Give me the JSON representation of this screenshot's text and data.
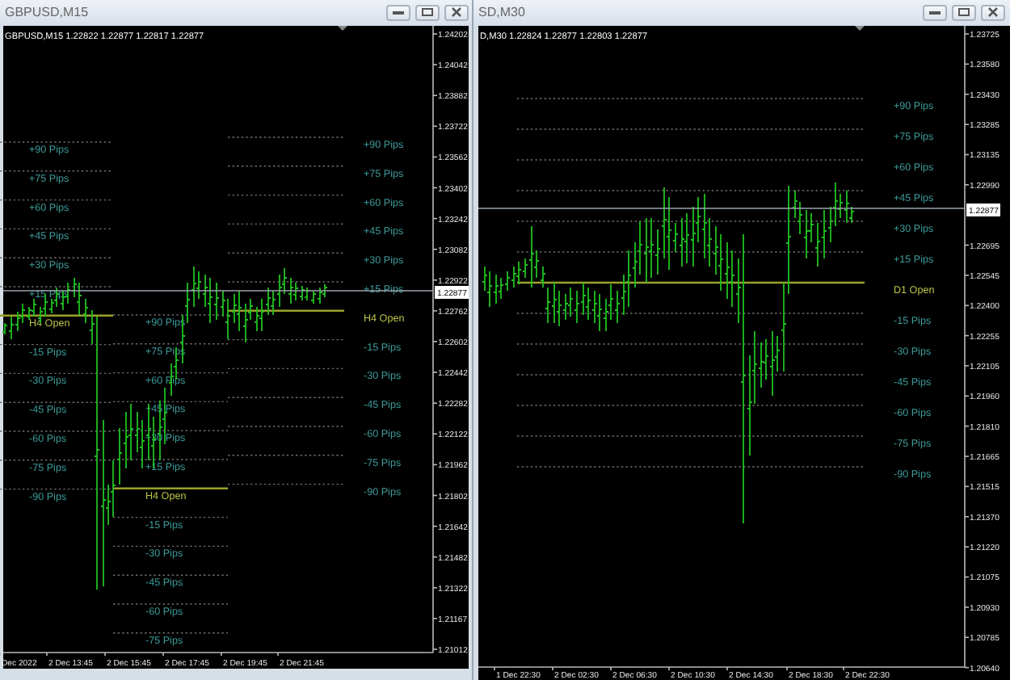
{
  "windows": [
    {
      "title": "GBPUSD,M15",
      "info": "GBPUSD,M15 1.22822 1.22877 1.22817 1.22877",
      "price_ticks": [
        "1.24202",
        "1.24042",
        "1.23882",
        "1.23722",
        "1.23562",
        "1.23402",
        "1.23242",
        "1.23082",
        "1.22922",
        "1.22762",
        "1.22602",
        "1.22442",
        "1.22282",
        "1.22122",
        "1.21962",
        "1.21802",
        "1.21642",
        "1.21482",
        "1.21322",
        "1.21167",
        "1.21012"
      ],
      "current_price": "1.22877",
      "time_labels": [
        "Dec 2022",
        "2 Dec 13:45",
        "2 Dec 15:45",
        "2 Dec 17:45",
        "2 Dec 19:45",
        "2 Dec 21:45"
      ],
      "pip_groups": [
        {
          "levels": [
            {
              "text": "+90 Pips",
              "kind": "pip"
            },
            {
              "text": "+75 Pips",
              "kind": "pip"
            },
            {
              "text": "+60 Pips",
              "kind": "pip"
            },
            {
              "text": "+45 Pips",
              "kind": "pip"
            },
            {
              "text": "+30 Pips",
              "kind": "pip"
            },
            {
              "text": "+15 Pips",
              "kind": "pip"
            },
            {
              "text": "H4 Open",
              "kind": "open"
            },
            {
              "text": "-15 Pips",
              "kind": "pip"
            },
            {
              "text": "-30 Pips",
              "kind": "pip"
            },
            {
              "text": "-45 Pips",
              "kind": "pip"
            },
            {
              "text": "-60 Pips",
              "kind": "pip"
            },
            {
              "text": "-75 Pips",
              "kind": "pip"
            },
            {
              "text": "-90 Pips",
              "kind": "pip"
            }
          ]
        },
        {
          "levels": [
            {
              "text": "+90 Pips",
              "kind": "pip"
            },
            {
              "text": "+75 Pips",
              "kind": "pip"
            },
            {
              "text": "+60 Pips",
              "kind": "pip"
            },
            {
              "text": "+45 Pips",
              "kind": "pip"
            },
            {
              "text": "+30 Pips",
              "kind": "pip"
            },
            {
              "text": "+15 Pips",
              "kind": "pip"
            },
            {
              "text": "H4 Open",
              "kind": "open"
            },
            {
              "text": "-15 Pips",
              "kind": "pip"
            },
            {
              "text": "-30 Pips",
              "kind": "pip"
            },
            {
              "text": "-45 Pips",
              "kind": "pip"
            },
            {
              "text": "-60 Pips",
              "kind": "pip"
            },
            {
              "text": "-75 Pips",
              "kind": "pip"
            }
          ]
        },
        {
          "levels": [
            {
              "text": "+90 Pips",
              "kind": "pip"
            },
            {
              "text": "+75 Pips",
              "kind": "pip"
            },
            {
              "text": "+60 Pips",
              "kind": "pip"
            },
            {
              "text": "+45 Pips",
              "kind": "pip"
            },
            {
              "text": "+30 Pips",
              "kind": "pip"
            },
            {
              "text": "+15 Pips",
              "kind": "pip"
            },
            {
              "text": "H4 Open",
              "kind": "open"
            },
            {
              "text": "-15 Pips",
              "kind": "pip"
            },
            {
              "text": "-30 Pips",
              "kind": "pip"
            },
            {
              "text": "-45 Pips",
              "kind": "pip"
            },
            {
              "text": "-60 Pips",
              "kind": "pip"
            },
            {
              "text": "-75 Pips",
              "kind": "pip"
            },
            {
              "text": "-90 Pips",
              "kind": "pip"
            }
          ]
        }
      ]
    },
    {
      "title": "SD,M30",
      "info": "D,M30 1.22824 1.22877 1.22803 1.22877",
      "price_ticks": [
        "1.23725",
        "1.23580",
        "1.23430",
        "1.23285",
        "1.23135",
        "1.22990",
        "1.22695",
        "1.22545",
        "1.22400",
        "1.22255",
        "1.22105",
        "1.21960",
        "1.21810",
        "1.21665",
        "1.21515",
        "1.21370",
        "1.21220",
        "1.21075",
        "1.20930",
        "1.20785",
        "1.20640"
      ],
      "current_price": "1.22877",
      "time_labels": [
        "1 Dec 22:30",
        "2 Dec 02:30",
        "2 Dec 06:30",
        "2 Dec 10:30",
        "2 Dec 14:30",
        "2 Dec 18:30",
        "2 Dec 22:30"
      ],
      "pip_groups": [
        {
          "levels": [
            {
              "text": "+90 Pips",
              "kind": "pip"
            },
            {
              "text": "+75 Pips",
              "kind": "pip"
            },
            {
              "text": "+60 Pips",
              "kind": "pip"
            },
            {
              "text": "+45 Pips",
              "kind": "pip"
            },
            {
              "text": "+30 Pips",
              "kind": "pip"
            },
            {
              "text": "+15 Pips",
              "kind": "pip"
            },
            {
              "text": "D1 Open",
              "kind": "open"
            },
            {
              "text": "-15 Pips",
              "kind": "pip"
            },
            {
              "text": "-30 Pips",
              "kind": "pip"
            },
            {
              "text": "-45 Pips",
              "kind": "pip"
            },
            {
              "text": "-60 Pips",
              "kind": "pip"
            },
            {
              "text": "-75 Pips",
              "kind": "pip"
            },
            {
              "text": "-90 Pips",
              "kind": "pip"
            }
          ]
        }
      ]
    }
  ]
}
